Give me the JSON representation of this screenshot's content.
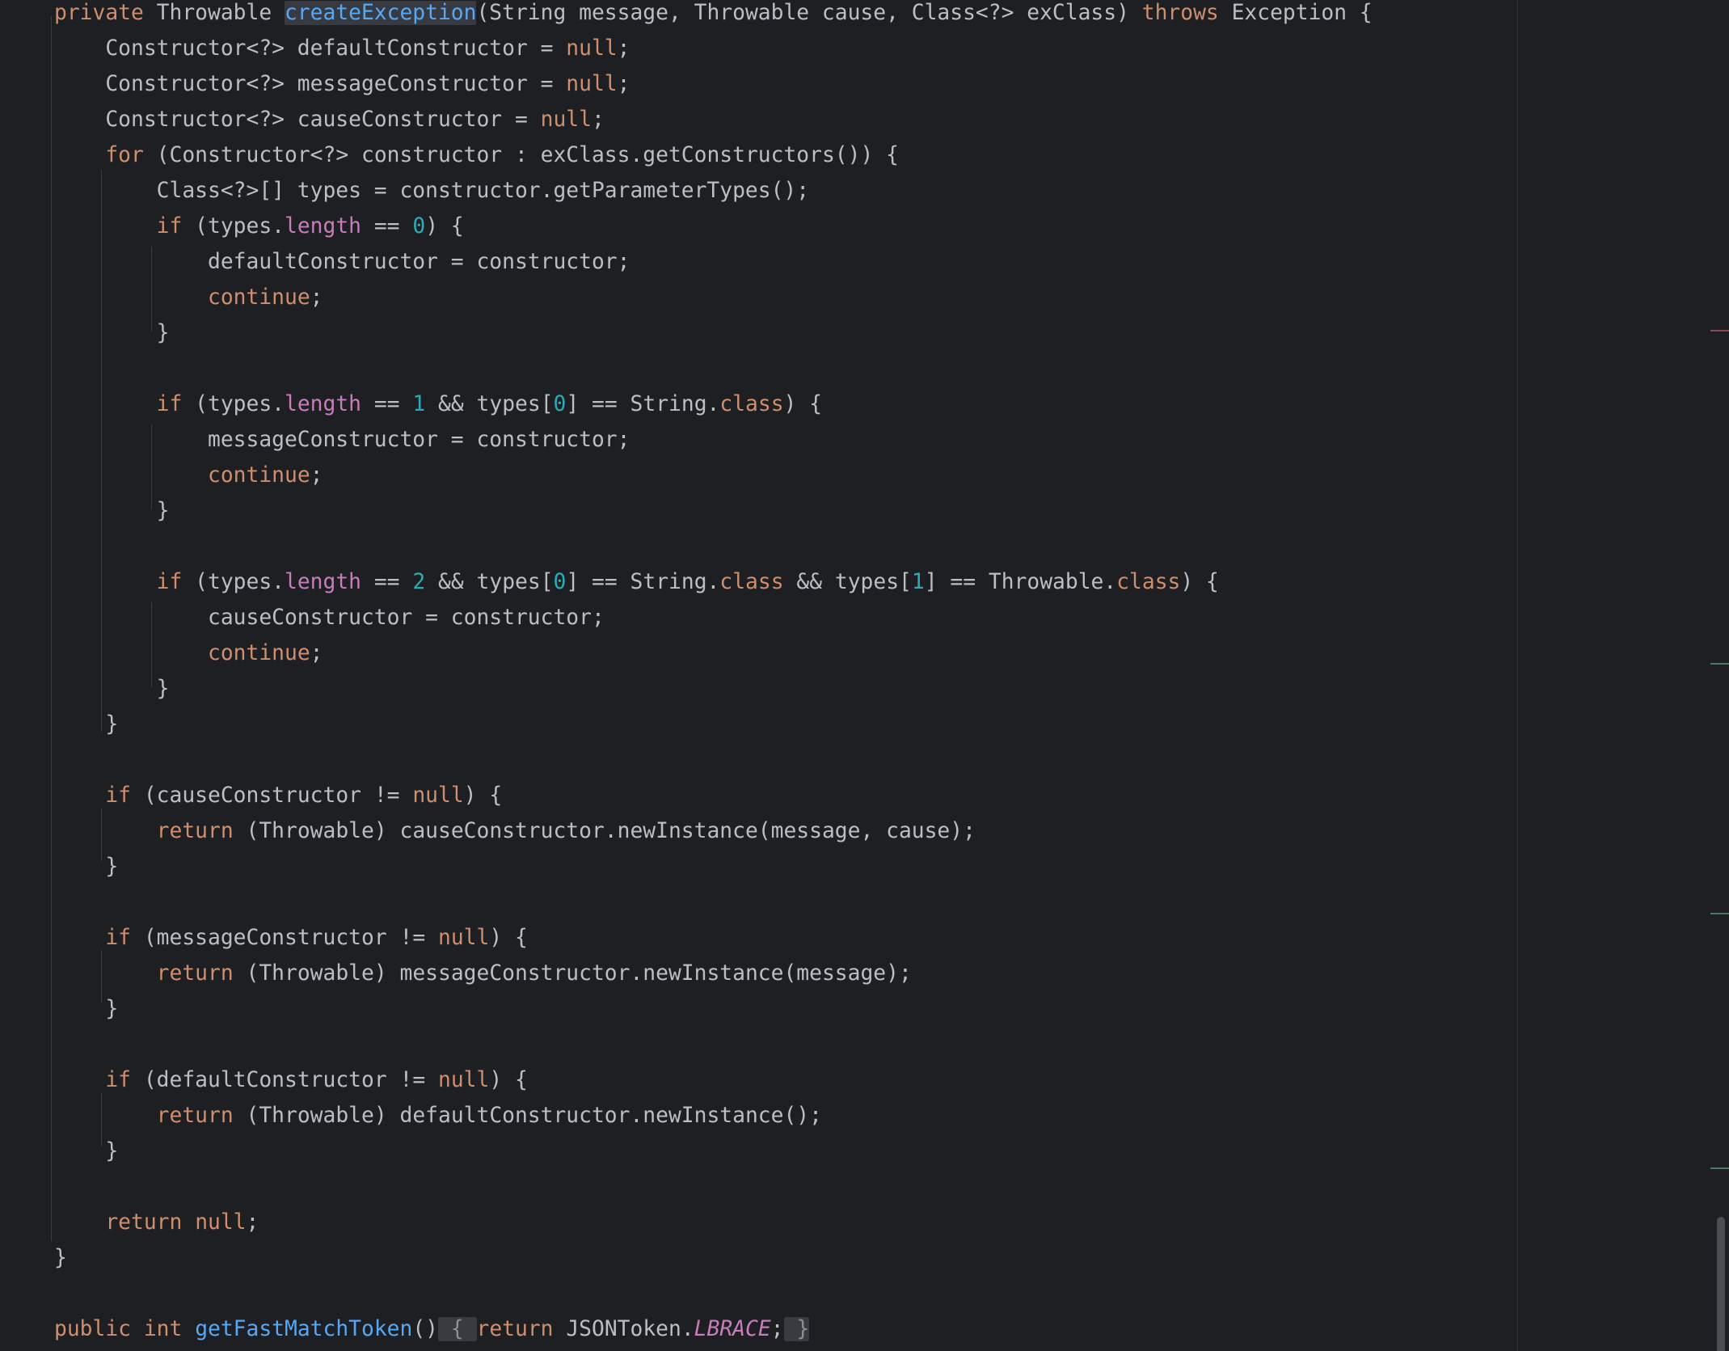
{
  "editor": {
    "language": "java",
    "highlighted_symbol": "createException",
    "lines": [
      [
        [
          "kw",
          "private"
        ],
        [
          "def",
          " Throwable "
        ],
        [
          "fn-hl",
          "createException"
        ],
        [
          "def",
          "(String message, Throwable cause, Class<?> exClass) "
        ],
        [
          "kw",
          "throws"
        ],
        [
          "def",
          " Exception {"
        ]
      ],
      [
        [
          "def",
          "    Constructor<?> defaultConstructor = "
        ],
        [
          "kw",
          "null"
        ],
        [
          "def",
          ";"
        ]
      ],
      [
        [
          "def",
          "    Constructor<?> messageConstructor = "
        ],
        [
          "kw",
          "null"
        ],
        [
          "def",
          ";"
        ]
      ],
      [
        [
          "def",
          "    Constructor<?> causeConstructor = "
        ],
        [
          "kw",
          "null"
        ],
        [
          "def",
          ";"
        ]
      ],
      [
        [
          "def",
          "    "
        ],
        [
          "kw",
          "for"
        ],
        [
          "def",
          " (Constructor<?> constructor : exClass.getConstructors()) {"
        ]
      ],
      [
        [
          "def",
          "        Class<?>[] types = constructor.getParameterTypes();"
        ]
      ],
      [
        [
          "def",
          "        "
        ],
        [
          "kw",
          "if"
        ],
        [
          "def",
          " (types."
        ],
        [
          "field",
          "length"
        ],
        [
          "def",
          " == "
        ],
        [
          "num",
          "0"
        ],
        [
          "def",
          ") {"
        ]
      ],
      [
        [
          "def",
          "            defaultConstructor = constructor;"
        ]
      ],
      [
        [
          "def",
          "            "
        ],
        [
          "kw",
          "continue"
        ],
        [
          "def",
          ";"
        ]
      ],
      [
        [
          "def",
          "        }"
        ]
      ],
      [],
      [
        [
          "def",
          "        "
        ],
        [
          "kw",
          "if"
        ],
        [
          "def",
          " (types."
        ],
        [
          "field",
          "length"
        ],
        [
          "def",
          " == "
        ],
        [
          "num",
          "1"
        ],
        [
          "def",
          " && types["
        ],
        [
          "num",
          "0"
        ],
        [
          "def",
          "] == String."
        ],
        [
          "kw",
          "class"
        ],
        [
          "def",
          ") {"
        ]
      ],
      [
        [
          "def",
          "            messageConstructor = constructor;"
        ]
      ],
      [
        [
          "def",
          "            "
        ],
        [
          "kw",
          "continue"
        ],
        [
          "def",
          ";"
        ]
      ],
      [
        [
          "def",
          "        }"
        ]
      ],
      [],
      [
        [
          "def",
          "        "
        ],
        [
          "kw",
          "if"
        ],
        [
          "def",
          " (types."
        ],
        [
          "field",
          "length"
        ],
        [
          "def",
          " == "
        ],
        [
          "num",
          "2"
        ],
        [
          "def",
          " && types["
        ],
        [
          "num",
          "0"
        ],
        [
          "def",
          "] == String."
        ],
        [
          "kw",
          "class"
        ],
        [
          "def",
          " && types["
        ],
        [
          "num",
          "1"
        ],
        [
          "def",
          "] == Throwable."
        ],
        [
          "kw",
          "class"
        ],
        [
          "def",
          ") {"
        ]
      ],
      [
        [
          "def",
          "            causeConstructor = constructor;"
        ]
      ],
      [
        [
          "def",
          "            "
        ],
        [
          "kw",
          "continue"
        ],
        [
          "def",
          ";"
        ]
      ],
      [
        [
          "def",
          "        }"
        ]
      ],
      [
        [
          "def",
          "    }"
        ]
      ],
      [],
      [
        [
          "def",
          "    "
        ],
        [
          "kw",
          "if"
        ],
        [
          "def",
          " (causeConstructor != "
        ],
        [
          "kw",
          "null"
        ],
        [
          "def",
          ") {"
        ]
      ],
      [
        [
          "def",
          "        "
        ],
        [
          "kw",
          "return"
        ],
        [
          "def",
          " (Throwable) causeConstructor.newInstance(message, cause);"
        ]
      ],
      [
        [
          "def",
          "    }"
        ]
      ],
      [],
      [
        [
          "def",
          "    "
        ],
        [
          "kw",
          "if"
        ],
        [
          "def",
          " (messageConstructor != "
        ],
        [
          "kw",
          "null"
        ],
        [
          "def",
          ") {"
        ]
      ],
      [
        [
          "def",
          "        "
        ],
        [
          "kw",
          "return"
        ],
        [
          "def",
          " (Throwable) messageConstructor.newInstance(message);"
        ]
      ],
      [
        [
          "def",
          "    }"
        ]
      ],
      [],
      [
        [
          "def",
          "    "
        ],
        [
          "kw",
          "if"
        ],
        [
          "def",
          " (defaultConstructor != "
        ],
        [
          "kw",
          "null"
        ],
        [
          "def",
          ") {"
        ]
      ],
      [
        [
          "def",
          "        "
        ],
        [
          "kw",
          "return"
        ],
        [
          "def",
          " (Throwable) defaultConstructor.newInstance();"
        ]
      ],
      [
        [
          "def",
          "    }"
        ]
      ],
      [],
      [
        [
          "def",
          "    "
        ],
        [
          "kw",
          "return"
        ],
        [
          "def",
          " "
        ],
        [
          "kw",
          "null"
        ],
        [
          "def",
          ";"
        ]
      ],
      [
        [
          "def",
          "}"
        ]
      ],
      [],
      [
        [
          "kw",
          "public"
        ],
        [
          "def",
          " "
        ],
        [
          "kw",
          "int"
        ],
        [
          "def",
          " "
        ],
        [
          "fn",
          "getFastMatchToken"
        ],
        [
          "def",
          "()"
        ],
        [
          "fold",
          " { "
        ],
        [
          "kw",
          "return"
        ],
        [
          "def",
          " JSONToken."
        ],
        [
          "static",
          "LBRACE"
        ],
        [
          "def",
          ";"
        ],
        [
          "fold",
          " }"
        ]
      ]
    ]
  },
  "colors": {
    "background": "#1e1f22",
    "keyword": "#cf8e6d",
    "function": "#56a8f5",
    "number": "#2aacb8",
    "field": "#c77dbb",
    "text": "#bcbec4",
    "stripe_red": "#8a4a55",
    "stripe_green": "#4a7a5e"
  }
}
